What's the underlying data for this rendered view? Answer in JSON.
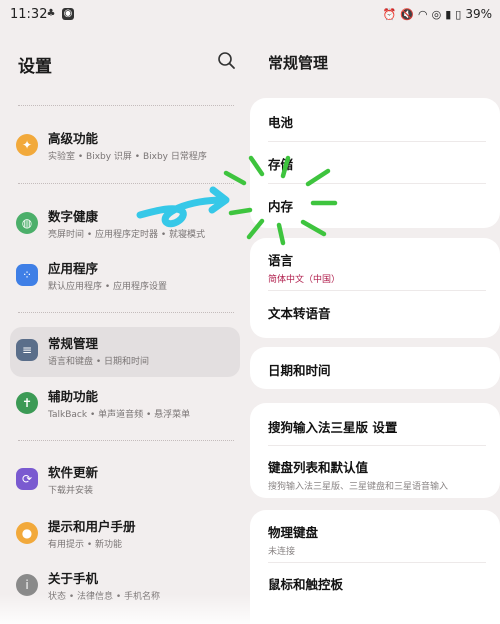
{
  "status_bar": {
    "time": "11:32",
    "battery": "39%",
    "left_icons": [
      "cleaner-icon",
      "app-icon"
    ],
    "right_icons": [
      "alarm-icon",
      "mute-icon",
      "wifi-icon",
      "hotspot-icon",
      "signal-icon",
      "battery-icon"
    ]
  },
  "left_panel": {
    "title": "设置",
    "items": [
      {
        "title": "高级功能",
        "subtitle": "实验室 • Bixby 识屏 • Bixby 日常程序",
        "icon": "star-icon",
        "color": "#f2a93b"
      },
      {
        "title": "数字健康",
        "subtitle": "亮屏时间 • 应用程序定时器 • 就寝模式",
        "icon": "wellbeing-icon",
        "color": "#4caf6a"
      },
      {
        "title": "应用程序",
        "subtitle": "默认应用程序 • 应用程序设置",
        "icon": "apps-icon",
        "color": "#3f7fe6"
      },
      {
        "title": "常规管理",
        "subtitle": "语言和键盘 • 日期和时间",
        "icon": "sliders-icon",
        "color": "#5a6e8a"
      },
      {
        "title": "辅助功能",
        "subtitle": "TalkBack • 单声道音频 • 悬浮菜单",
        "icon": "accessibility-icon",
        "color": "#3c9a55"
      },
      {
        "title": "软件更新",
        "subtitle": "下载并安装",
        "icon": "update-icon",
        "color": "#7a5ad0"
      },
      {
        "title": "提示和用户手册",
        "subtitle": "有用提示 • 新功能",
        "icon": "bulb-icon",
        "color": "#f2a93b"
      },
      {
        "title": "关于手机",
        "subtitle": "状态 • 法律信息 • 手机名称",
        "icon": "info-icon",
        "color": "#8a8a8a"
      }
    ]
  },
  "right_panel": {
    "title": "常规管理",
    "group1": [
      {
        "title": "电池"
      },
      {
        "title": "存储"
      },
      {
        "title": "内存"
      }
    ],
    "group2": [
      {
        "title": "语言",
        "subtitle": "简体中文（中国）"
      },
      {
        "title": "文本转语音"
      }
    ],
    "group3": [
      {
        "title": "日期和时间"
      }
    ],
    "group4": [
      {
        "title": "搜狗输入法三星版 设置"
      },
      {
        "title": "键盘列表和默认值",
        "subtitle": "搜狗输入法三星版、三星键盘和三星语音输入"
      }
    ],
    "group5": [
      {
        "title": "物理键盘",
        "subtitle": "未连接"
      },
      {
        "title": "鼠标和触控板"
      }
    ]
  },
  "colors": {
    "background": "#f2eeee",
    "card": "#ffffff",
    "accent_red": "#b01e4c",
    "arrow": "#36c8e8",
    "burst": "#3ec43e"
  }
}
